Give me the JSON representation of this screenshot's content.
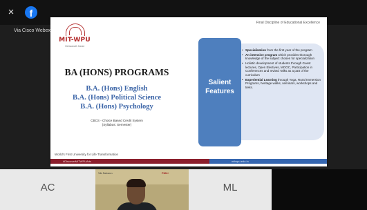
{
  "window": {
    "close_glyph": "×",
    "facebook_glyph": "f",
    "via_label": "Via Cisco Webex"
  },
  "slide": {
    "top_right_text": "Final Discipline of Educational Excellence",
    "logo": {
      "name": "MIT-WPU",
      "subtitle": "Vishwanath Karad"
    },
    "title": "BA (HONS) PROGRAMS",
    "programs": [
      "B.A. (Hons) English",
      "B.A. (Hons) Political Science",
      "B.A. (Hons) Psychology"
    ],
    "cbcs_line1": "CBCS - Choice Based Credit System",
    "cbcs_line2": "(Syllabus: Semester)",
    "features_heading": "Salient Features",
    "features": [
      {
        "bold": "Specialization",
        "text": " from the first year of the program"
      },
      {
        "bold": "An intensive program",
        "text": " which provides thorough knowledge of the subject chosen for specialization"
      },
      {
        "bold": "",
        "text": "Holistic development of students through Guest lectures, Open Electives, MOOC, Participation in Conferences and Invited Talks as a part of the curriculum"
      },
      {
        "bold": "Experiential Learning",
        "text": " through Yoga, Rural Immersion Programs, heritage walks, seminars, workshops and treks."
      }
    ],
    "footer_text": "World's First University for Life Transformation",
    "footer_tag_left": "#DiscoverMITWPUArts",
    "footer_tag_right": "mitwpu.edu.in"
  },
  "participants": [
    {
      "initials": "AC"
    },
    {
      "name": "Vik Sabrem",
      "sign": "PMLI"
    },
    {
      "initials": "ML"
    }
  ],
  "colors": {
    "accent_blue": "#4e7fbe",
    "brand_red": "#b22a2a",
    "bubble": "#dfe6f3",
    "facebook": "#1877f2"
  }
}
